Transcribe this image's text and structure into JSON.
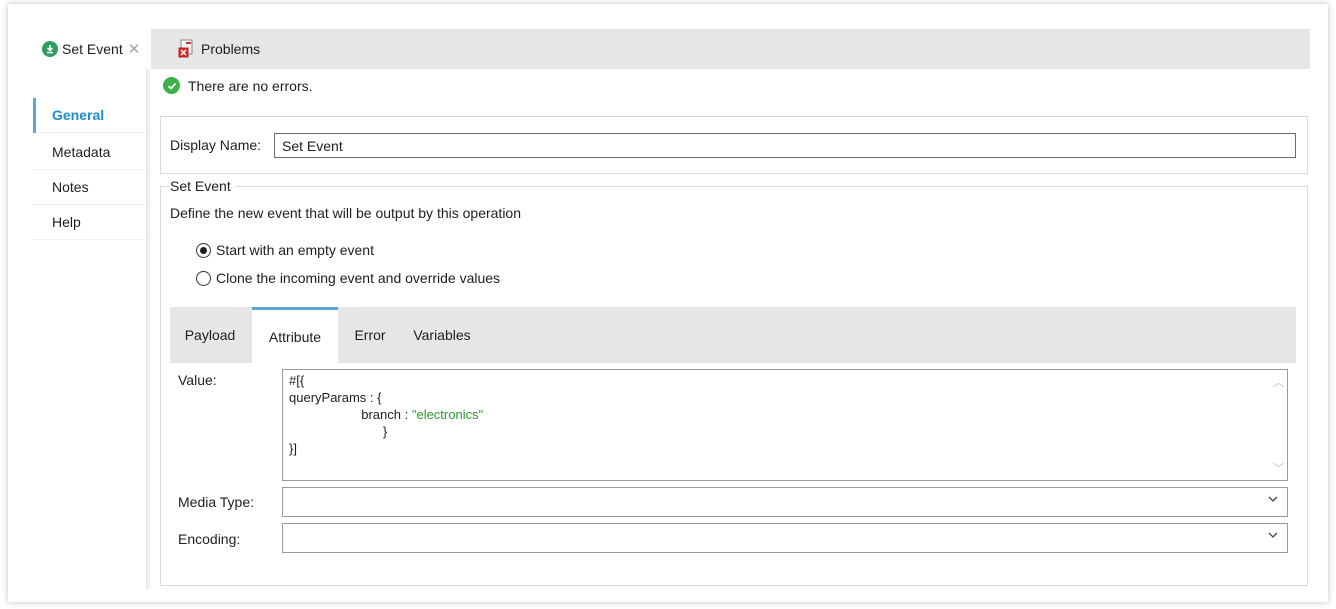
{
  "editor_tabs": [
    {
      "label": "Set Event",
      "active": true
    },
    {
      "label": "Problems",
      "active": false
    }
  ],
  "left_nav": {
    "items": [
      {
        "label": "General",
        "active": true
      },
      {
        "label": "Metadata",
        "active": false
      },
      {
        "label": "Notes",
        "active": false
      },
      {
        "label": "Help",
        "active": false
      }
    ]
  },
  "status": {
    "text": "There are no errors."
  },
  "display_name": {
    "label": "Display Name:",
    "value": "Set Event"
  },
  "set_event_group": {
    "legend": "Set Event",
    "description": "Define the new event that will be output by this operation",
    "options": [
      {
        "label": "Start with an empty event",
        "selected": true
      },
      {
        "label": "Clone the incoming event and override values",
        "selected": false
      }
    ]
  },
  "inner_tabs": [
    {
      "label": "Payload",
      "active": false
    },
    {
      "label": "Attribute",
      "active": true
    },
    {
      "label": "Error",
      "active": false
    },
    {
      "label": "Variables",
      "active": false
    }
  ],
  "fields": {
    "value_label": "Value:",
    "value_code": {
      "line1": "#[{",
      "line2": "queryParams : {",
      "line3_key": "branch : ",
      "line3_str": "\"electronics\"",
      "line4": "}",
      "line5": "}]"
    },
    "media_type_label": "Media Type:",
    "media_type_value": "",
    "encoding_label": "Encoding:",
    "encoding_value": ""
  },
  "colors": {
    "accent": "#1c8dcc",
    "ok_green": "#3db04a",
    "string_green": "#2e9a2e"
  }
}
